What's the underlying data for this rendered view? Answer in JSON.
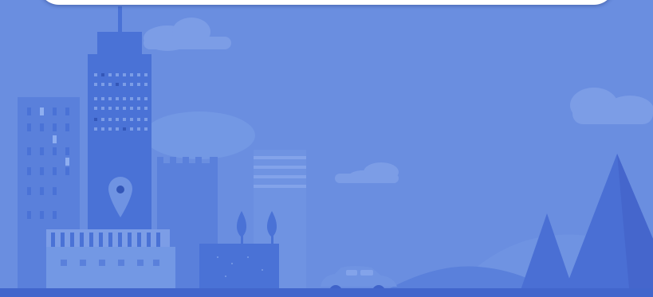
{
  "colors": {
    "sky": "#6a8ee0",
    "sky_light": "#7398e4",
    "cloud": "#7ea0e8",
    "building_dark": "#4a72d6",
    "building_mid": "#5a80db",
    "building_light": "#6f93e2",
    "window": "#8eaef0",
    "window_dark": "#3457b8",
    "ground": "#3f63c9",
    "mountain": "#4668d0",
    "card": "#ffffff"
  },
  "icons": {
    "location": "location-pin-icon",
    "car": "car-icon"
  }
}
